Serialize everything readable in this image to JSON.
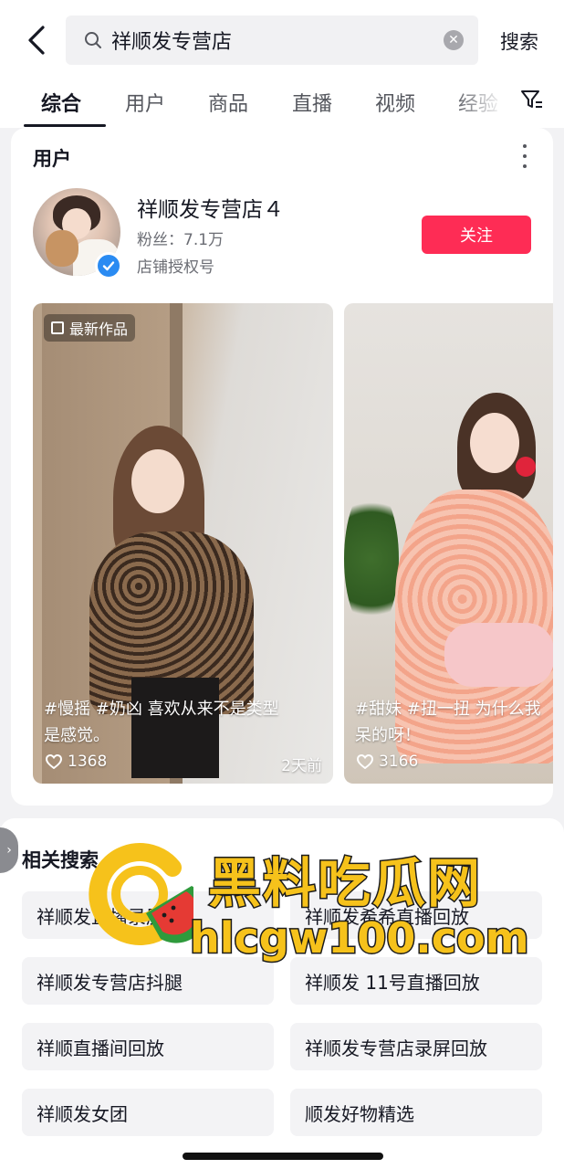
{
  "header": {
    "search_query": "祥顺发专营店",
    "search_button": "搜索"
  },
  "tabs": [
    {
      "label": "综合",
      "active": true
    },
    {
      "label": "用户",
      "active": false
    },
    {
      "label": "商品",
      "active": false
    },
    {
      "label": "直播",
      "active": false
    },
    {
      "label": "视频",
      "active": false
    },
    {
      "label": "经验",
      "active": false
    }
  ],
  "user_section": {
    "title": "用户",
    "username": "祥顺发专营店４",
    "followers": "粉丝：7.1万",
    "auth_label": "店铺授权号",
    "follow_button": "关注",
    "verified": true
  },
  "videos": [
    {
      "badge": "最新作品",
      "caption_line1": "#慢摇 #奶凶 喜欢从来不是类型",
      "caption_line2": "是感觉。",
      "likes": "1368",
      "time_ago": "2天前"
    },
    {
      "badge": "",
      "caption_line1": "#甜妹 #扭一扭 为什么我",
      "caption_line2": "呆的呀！",
      "likes": "3166",
      "time_ago": ""
    }
  ],
  "related": {
    "title": "相关搜索",
    "items": [
      "祥顺发直播录屏",
      "祥顺发希希直播回放",
      "祥顺发专营店抖腿",
      "祥顺发 11号直播回放",
      "祥顺直播间回放",
      "祥顺发专营店录屏回放",
      "祥顺发女团",
      "顺发好物精选"
    ]
  },
  "watermark": {
    "title": "黑料吃瓜网",
    "url": "hlcgw100.com"
  },
  "colors": {
    "accent": "#fe2c55",
    "verified": "#2a8bf2",
    "watermark": "#f6c21b"
  },
  "icons": [
    "back-arrow-icon",
    "search-icon",
    "clear-icon",
    "filter-icon",
    "more-dots-icon",
    "verified-icon",
    "video-badge-icon",
    "heart-icon",
    "chevron-right-icon"
  ]
}
